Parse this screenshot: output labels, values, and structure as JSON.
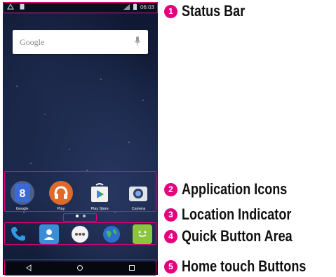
{
  "status_bar": {
    "time": "06:03"
  },
  "search": {
    "brand_text": "Google"
  },
  "apps": [
    {
      "label": "Google",
      "icon": "google-folder-icon"
    },
    {
      "label": "Play",
      "icon": "play-music-icon"
    },
    {
      "label": "Play Store",
      "icon": "play-store-icon"
    },
    {
      "label": "Camera",
      "icon": "camera-icon"
    }
  ],
  "dock": [
    {
      "icon": "phone-icon"
    },
    {
      "icon": "contacts-icon"
    },
    {
      "icon": "apps-drawer-icon"
    },
    {
      "icon": "browser-globe-icon"
    },
    {
      "icon": "messaging-icon"
    }
  ],
  "nav": [
    {
      "icon": "back-icon"
    },
    {
      "icon": "home-icon"
    },
    {
      "icon": "recents-icon"
    }
  ],
  "callouts": [
    {
      "number": "1",
      "label": "Status Bar"
    },
    {
      "number": "2",
      "label": "Application Icons"
    },
    {
      "number": "3",
      "label": "Location Indicator"
    },
    {
      "number": "4",
      "label": "Quick Button Area"
    },
    {
      "number": "5",
      "label": "Home touch Buttons"
    }
  ],
  "colors": {
    "highlight": "#e6007e",
    "screen_bg": "#172445"
  }
}
